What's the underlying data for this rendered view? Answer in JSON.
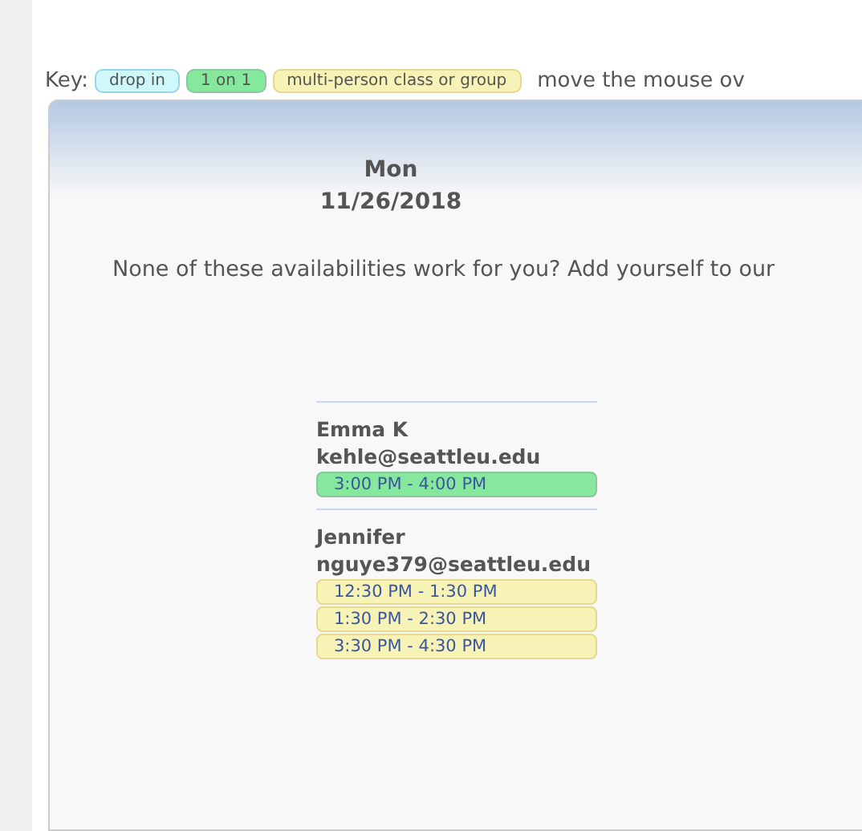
{
  "key": {
    "label": "Key:",
    "items": [
      {
        "label": "drop in",
        "kind": "dropin"
      },
      {
        "label": "1 on 1",
        "kind": "oneonone"
      },
      {
        "label": "multi-person class or group",
        "kind": "group"
      }
    ],
    "hint": "move the mouse ov"
  },
  "day": {
    "weekday": "Mon",
    "date": "11/26/2018"
  },
  "message": "None of these availabilities work for you? Add yourself to our",
  "people": [
    {
      "name": "Emma K",
      "email": "kehle@seattleu.edu",
      "slots": [
        {
          "time": "3:00 PM - 4:00 PM",
          "kind": "oneonone"
        }
      ]
    },
    {
      "name": "Jennifer",
      "email": "nguye379@seattleu.edu",
      "slots": [
        {
          "time": "12:30 PM - 1:30 PM",
          "kind": "group"
        },
        {
          "time": "1:30 PM - 2:30 PM",
          "kind": "group"
        },
        {
          "time": "3:30 PM - 4:30 PM",
          "kind": "group"
        }
      ]
    }
  ]
}
